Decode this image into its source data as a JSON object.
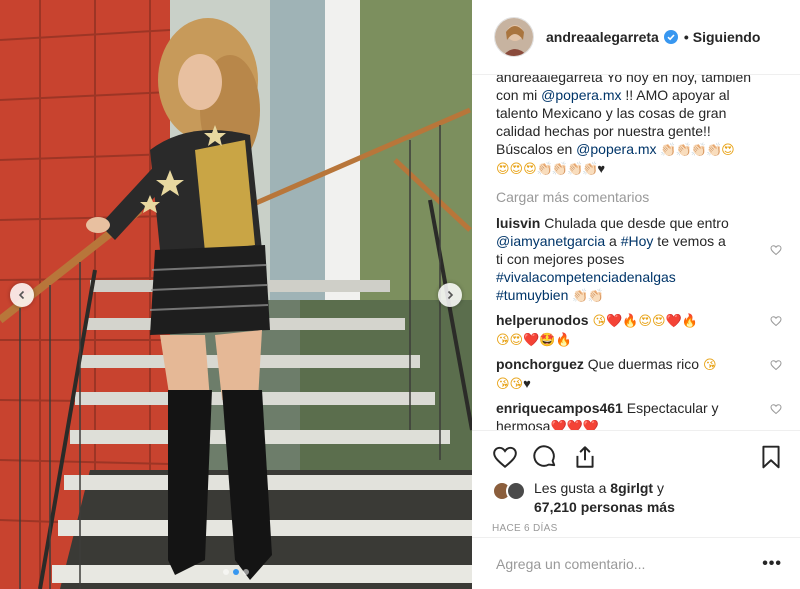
{
  "post": {
    "username": "andreaalegarreta",
    "follow_sep": "•",
    "follow_label": "Siguiendo"
  },
  "caption": {
    "line1": "andreaalegarreta Yo hoy en hoy, también",
    "line2_prefix": "con mi ",
    "mention_popera": "@popera.mx",
    "line2_suffix": " !! AMO apoyar al",
    "line3": "talento Mexicano y las cosas de gran",
    "line4": "calidad hechas por nuestra gente!!",
    "line5_prefix": "Búscalos en ",
    "line5_mention": "@popera.mx",
    "line5_emoji": "👏🏻👏🏻👏🏻👏🏻",
    "line5_emoji2": "😍",
    "line6_emoji": "😍😍😍",
    "line6_clap": "👏🏻👏🏻👏🏻👏🏻",
    "line6_heart": "♥"
  },
  "load_more": "Cargar más comentarios",
  "comments": [
    {
      "user": "luisvin",
      "text1": " Chulada que desde que entro",
      "mention": "@iamyanetgarcia",
      "text2": " a ",
      "tag": "#Hoy",
      "text3": " te vemos a",
      "text4": "ti con mejores poses",
      "tag2": "#vivalacompetenciadenalgas",
      "tag3": "#tumuybien",
      "emoji": "👏🏻👏🏻"
    },
    {
      "user": "helperunodos",
      "emoji1": "😘",
      "heart1": "❤️",
      "fire1": "🔥",
      "face1": "😍😍",
      "heart2": "❤️",
      "fire2": "🔥",
      "emoji2": "😘😍",
      "heart3": "❤️",
      "face2": "🤩",
      "fire3": "🔥"
    },
    {
      "user": "ponchorguez",
      "text": " Que duermas rico ",
      "emoji1": "😘",
      "emoji2": "😘😘",
      "heart": "♥"
    },
    {
      "user": "enriquecampos461",
      "text": " Espectacular y",
      "text2": "hermosa",
      "hearts": "❤️❤️❤️"
    }
  ],
  "likes": {
    "prefix": "Les gusta a ",
    "user": "8girlgt",
    "mid": " y",
    "count": "67,210 personas más"
  },
  "time_ago": "HACE 6 DÍAS",
  "add_comment_placeholder": "Agrega un comentario...",
  "more_label": "•••",
  "colors": {
    "link": "#003569",
    "verified": "#3897f0",
    "muted": "#999999"
  }
}
